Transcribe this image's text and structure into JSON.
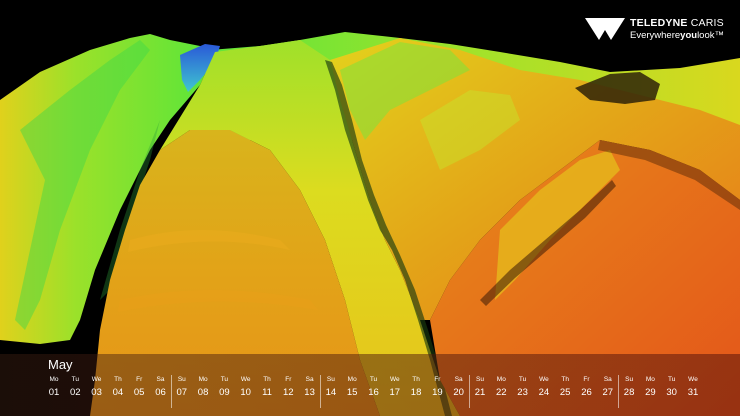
{
  "logo": {
    "brand_bold": "TELEDYNE",
    "brand_light": "CARIS",
    "tagline_start": "Everywhere",
    "tagline_bold": "you",
    "tagline_end": "look",
    "trademark": "™"
  },
  "calendar": {
    "month": "May",
    "days": [
      {
        "dow": "Mo",
        "num": "01"
      },
      {
        "dow": "Tu",
        "num": "02"
      },
      {
        "dow": "We",
        "num": "03"
      },
      {
        "dow": "Th",
        "num": "04"
      },
      {
        "dow": "Fr",
        "num": "05"
      },
      {
        "dow": "Sa",
        "num": "06"
      },
      {
        "dow": "Su",
        "num": "07"
      },
      {
        "dow": "Mo",
        "num": "08"
      },
      {
        "dow": "Tu",
        "num": "09"
      },
      {
        "dow": "We",
        "num": "10"
      },
      {
        "dow": "Th",
        "num": "11"
      },
      {
        "dow": "Fr",
        "num": "12"
      },
      {
        "dow": "Sa",
        "num": "13"
      },
      {
        "dow": "Su",
        "num": "14"
      },
      {
        "dow": "Mo",
        "num": "15"
      },
      {
        "dow": "Tu",
        "num": "16"
      },
      {
        "dow": "We",
        "num": "17"
      },
      {
        "dow": "Th",
        "num": "18"
      },
      {
        "dow": "Fr",
        "num": "19"
      },
      {
        "dow": "Sa",
        "num": "20"
      },
      {
        "dow": "Su",
        "num": "21"
      },
      {
        "dow": "Mo",
        "num": "22"
      },
      {
        "dow": "Tu",
        "num": "23"
      },
      {
        "dow": "We",
        "num": "24"
      },
      {
        "dow": "Th",
        "num": "25"
      },
      {
        "dow": "Fr",
        "num": "26"
      },
      {
        "dow": "Sa",
        "num": "27"
      },
      {
        "dow": "Su",
        "num": "28"
      },
      {
        "dow": "Mo",
        "num": "29"
      },
      {
        "dow": "Tu",
        "num": "30"
      },
      {
        "dow": "We",
        "num": "31"
      }
    ]
  },
  "colors": {
    "background": "#000000",
    "terrain_deep": "#1f6fd6",
    "terrain_mid": "#57e83a",
    "terrain_shallow": "#e8d11a",
    "terrain_high": "#e8661a",
    "calendar_band": "#5a1a0a"
  }
}
